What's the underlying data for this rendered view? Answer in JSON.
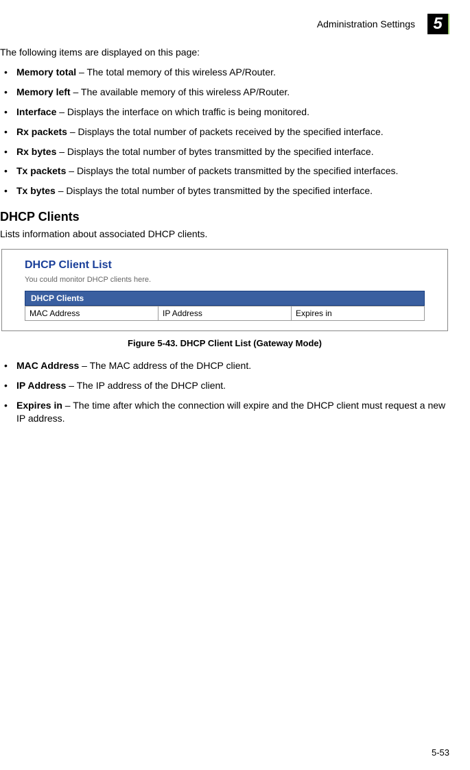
{
  "header": {
    "title": "Administration Settings",
    "chapter": "5"
  },
  "intro": "The following items are displayed on this page:",
  "items1": [
    {
      "term": "Memory total",
      "desc": " – The total memory of this wireless AP/Router."
    },
    {
      "term": "Memory left",
      "desc": " – The available memory of this wireless AP/Router."
    },
    {
      "term": "Interface",
      "desc": " – Displays the interface on which traffic is being monitored."
    },
    {
      "term": "Rx packets",
      "desc": " – Displays the total number of packets received by the specified interface."
    },
    {
      "term": "Rx bytes",
      "desc": " – Displays the total number of bytes transmitted by the specified interface."
    },
    {
      "term": "Tx packets",
      "desc": " – Displays the total number of packets transmitted by the specified interfaces."
    },
    {
      "term": "Tx bytes",
      "desc": " – Displays the total number of bytes transmitted by the specified interface."
    }
  ],
  "section": {
    "title": "DHCP Clients",
    "desc": "Lists information about associated DHCP clients."
  },
  "screenshot": {
    "title": "DHCP Client List",
    "sub": "You could monitor DHCP clients here.",
    "bar": "DHCP Clients",
    "col1": "MAC Address",
    "col2": "IP Address",
    "col3": "Expires in"
  },
  "figure_caption": "Figure 5-43.   DHCP Client List (Gateway Mode)",
  "items2": [
    {
      "term": "MAC Address",
      "desc": " – The MAC address of the DHCP client."
    },
    {
      "term": "IP Address",
      "desc": " – The IP address of the DHCP client."
    },
    {
      "term": "Expires in",
      "desc": " – The time after which the connection will expire and the DHCP client must request a new IP address."
    }
  ],
  "page_num": "5-53"
}
